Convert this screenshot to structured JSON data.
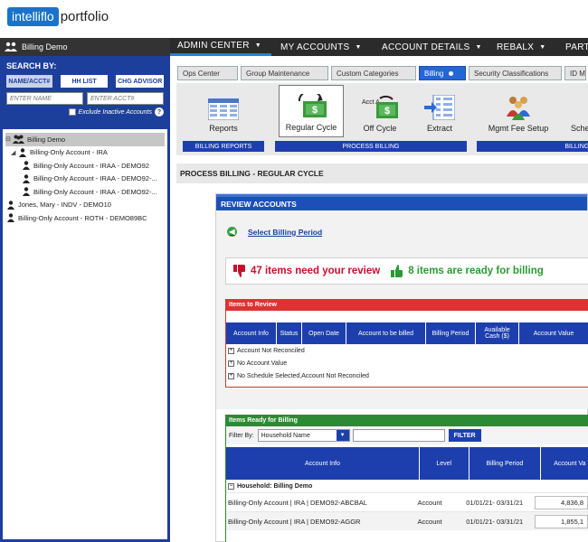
{
  "logo": {
    "part1": "intelliflo",
    "part2": "portfolio"
  },
  "client": {
    "name": "Billing Demo"
  },
  "nav": [
    {
      "label": "ADMIN CENTER",
      "caret": "▼"
    },
    {
      "label": "MY ACCOUNTS",
      "caret": "▼"
    },
    {
      "label": "ACCOUNT DETAILS",
      "caret": "▼"
    },
    {
      "label": "REBALX",
      "caret": "▼"
    },
    {
      "label": "PART",
      "caret": ""
    }
  ],
  "search": {
    "title": "SEARCH BY:",
    "buttons": [
      "NAME/ACCT#",
      "HH LIST",
      "CHG ADVISOR"
    ],
    "name_placeholder": "ENTER NAME",
    "acct_placeholder": "ENTER ACCT#",
    "exclude_label": "Exclude Inactive Accounts",
    "help": "?"
  },
  "tree": [
    {
      "label": "Billing Demo",
      "toggle": "⊟",
      "icon": "group",
      "indent": 0
    },
    {
      "label": "Billing-Only Account - IRA",
      "toggle": "◢",
      "icon": "person",
      "indent": 1
    },
    {
      "label": "Billing-Only Account - IRAA - DEMO92",
      "toggle": "",
      "icon": "person",
      "indent": 2
    },
    {
      "label": "Billing-Only Account - IRAA - DEMO92-...",
      "toggle": "",
      "icon": "person",
      "indent": 2
    },
    {
      "label": "Billing-Only Account - IRAA - DEMO92-...",
      "toggle": "",
      "icon": "person",
      "indent": 2
    },
    {
      "label": "Jones, Mary - INDV - DEMO10",
      "toggle": "",
      "icon": "person",
      "indent": 0
    },
    {
      "label": "Billing-Only Account - ROTH - DEMO89BC",
      "toggle": "",
      "icon": "person",
      "indent": 0
    }
  ],
  "tabs": [
    "Ops Center",
    "Group Maintenance",
    "Custom Categories",
    "Billing",
    "Security Classifications",
    "ID M"
  ],
  "ribbon": {
    "reports": {
      "label": "Reports",
      "group": "BILLING REPORTS"
    },
    "regular": {
      "label": "Regular Cycle"
    },
    "offcycle": {
      "label": "Off Cycle",
      "badge": "Acct A"
    },
    "extract": {
      "label": "Extract"
    },
    "process_group": "PROCESS BILLING",
    "mgmt": {
      "label": "Mgmt Fee Setup"
    },
    "sched": {
      "label": "Sche"
    },
    "billing_group": "BILLING M"
  },
  "section_title": "PROCESS BILLING - REGULAR CYCLE",
  "review": {
    "header": "REVIEW ACCOUNTS",
    "select_period": "Select Billing Period",
    "needs_review": "47 items need your review",
    "ready": "8 items are ready for billing",
    "items_to_review": "Items to Review",
    "columns": [
      "Account Info",
      "Status",
      "Open Date",
      "Account to be billed",
      "Billing Period",
      "Available Cash ($)",
      "Account Value"
    ],
    "groups": [
      "Account Not Reconciled",
      "No Account Value",
      "No Schedule Selected,Account Not Reconciled"
    ],
    "ready_label": "Items Ready for Billing",
    "filter_by": "Filter By:",
    "filter_value": "Household Name",
    "filter_btn": "FILTER",
    "ready_columns": [
      "Account Info",
      "Level",
      "Billing Period",
      "Account Va"
    ],
    "household": "Household: Billing Demo",
    "rows": [
      {
        "info": "Billing-Only Account | IRA | DEMO92-ABCBAL",
        "level": "Account",
        "period": "01/01/21- 03/31/21",
        "value": "4,836,8"
      },
      {
        "info": "Billing-Only Account | IRA | DEMO92-AGGR",
        "level": "Account",
        "period": "01/01/21- 03/31/21",
        "value": "1,855,1"
      }
    ]
  },
  "colors": {
    "brand": "#1a73c8",
    "nav": "#2b2b2b",
    "panel": "#1d3f9c",
    "red": "#c8102e",
    "green": "#2a9a34"
  }
}
